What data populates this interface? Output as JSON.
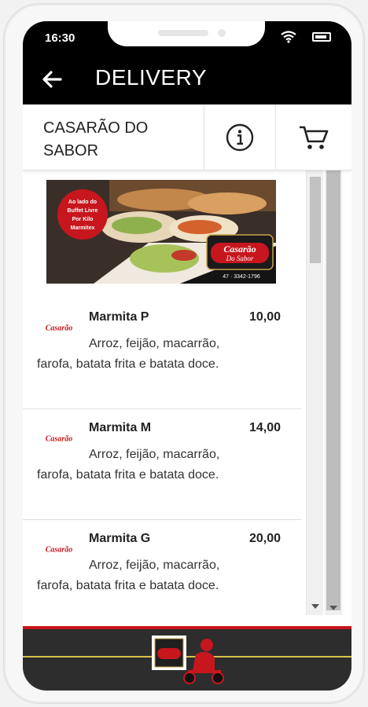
{
  "status_bar": {
    "time": "16:30"
  },
  "app_bar": {
    "title": "DELIVERY"
  },
  "restaurant": {
    "name": "CASARÃO DO SABOR"
  },
  "banner": {
    "badge_text": [
      "Ao lado do",
      "Buffet Livre",
      "Por Kilo",
      "Marmitex"
    ],
    "logo_line1": "Casarão",
    "logo_line2": "Do Sabor",
    "phone": "47 · 3342-1796"
  },
  "menu_items": [
    {
      "name": "Marmita P",
      "price": "10,00",
      "description": "Arroz, feijão, macarrão, farofa, batata frita e batata doce.",
      "logo_text": "Casarão"
    },
    {
      "name": "Marmita M",
      "price": "14,00",
      "description": "Arroz, feijão, macarrão, farofa, batata frita e batata doce.",
      "logo_text": "Casarão"
    },
    {
      "name": "Marmita G",
      "price": "20,00",
      "description": "Arroz, feijão, macarrão, farofa, batata frita e batata doce.",
      "logo_text": "Casarão"
    }
  ],
  "colors": {
    "brand_red": "#c7161e",
    "bar_black": "#000000"
  },
  "icons": {
    "back": "arrow-left",
    "info": "info-circle",
    "cart": "shopping-cart"
  }
}
